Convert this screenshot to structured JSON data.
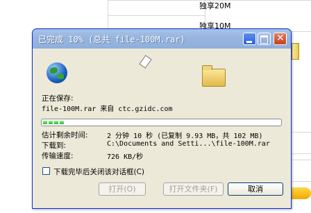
{
  "background": {
    "items": [
      "独享20M",
      "独享10M"
    ]
  },
  "dialog": {
    "title": "已完成 10% (总共 file-100M.rar)",
    "saving_label": "正在保存:",
    "saving_file": "file-100M.rar 来自 ctc.gzidc.com",
    "progress_percent": 10,
    "fields": [
      {
        "label": "估计剩余时间:",
        "value": "2 分钟 10 秒 (已复制 9.93 MB，共 102 MB)"
      },
      {
        "label": "下载到:",
        "value": "C:\\Documents and Setti...\\file-100M.rar"
      },
      {
        "label": "传输速度:",
        "value": "726 KB/秒"
      }
    ],
    "close_on_complete_label": "下载完毕后关闭该对话框(C)",
    "close_on_complete_checked": false,
    "buttons": {
      "open": "打开(O)",
      "open_folder": "打开文件夹(F)",
      "cancel": "取消"
    }
  },
  "colors": {
    "title_bar": "#98b4de",
    "dialog_bg": "#ece9d8",
    "progress": "#22b822"
  }
}
